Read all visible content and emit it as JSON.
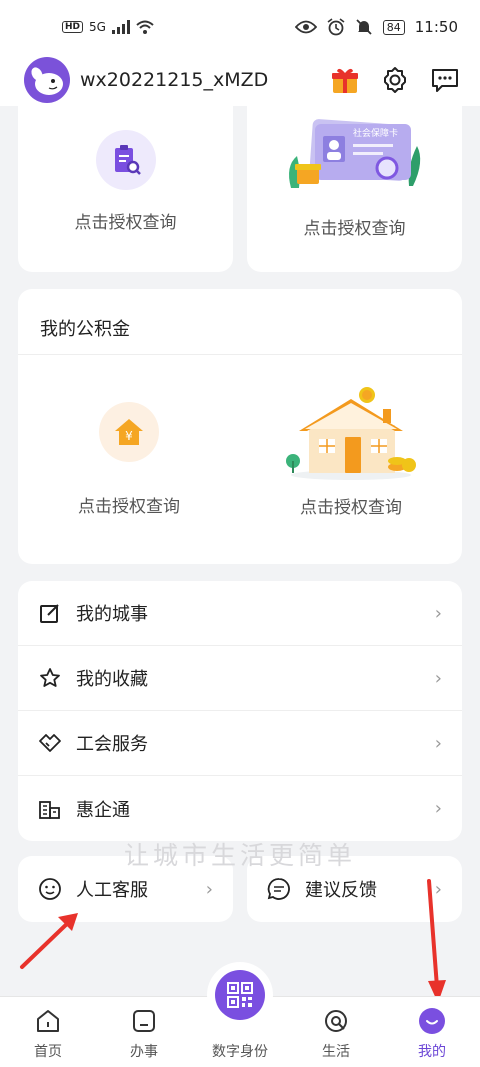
{
  "status_bar": {
    "network": "5G",
    "hd": "HD",
    "battery": "84",
    "time": "11:50"
  },
  "header": {
    "username": "wx20221215_xMZD",
    "icons": [
      "gift-icon",
      "gear-icon",
      "chat-icon"
    ]
  },
  "social_cards": [
    {
      "label": "点击授权查询",
      "icon": "clipboard-search-icon"
    },
    {
      "label": "点击授权查询",
      "icon": "social-security-card-illustration",
      "card_text": "社会保障卡"
    }
  ],
  "fund": {
    "title": "我的公积金",
    "items": [
      {
        "label": "点击授权查询",
        "icon": "yuan-house-icon",
        "glyph": "¥"
      },
      {
        "label": "点击授权查询",
        "icon": "house-coins-illustration"
      }
    ]
  },
  "menu": [
    {
      "label": "我的城事",
      "icon": "edit-icon"
    },
    {
      "label": "我的收藏",
      "icon": "star-icon"
    },
    {
      "label": "工会服务",
      "icon": "handshake-icon"
    },
    {
      "label": "惠企通",
      "icon": "building-icon"
    }
  ],
  "bottom_cards": [
    {
      "label": "人工客服",
      "icon": "support-icon"
    },
    {
      "label": "建议反馈",
      "icon": "feedback-icon"
    }
  ],
  "slogan": "让城市生活更简单",
  "tabs": [
    {
      "label": "首页",
      "icon": "home-icon"
    },
    {
      "label": "办事",
      "icon": "task-icon"
    },
    {
      "label": "数字身份",
      "icon": "qr-code-icon"
    },
    {
      "label": "生活",
      "icon": "life-icon"
    },
    {
      "label": "我的",
      "icon": "profile-icon"
    }
  ],
  "colors": {
    "accent": "#7a4fe0",
    "annotation_arrow": "#e8322b"
  }
}
